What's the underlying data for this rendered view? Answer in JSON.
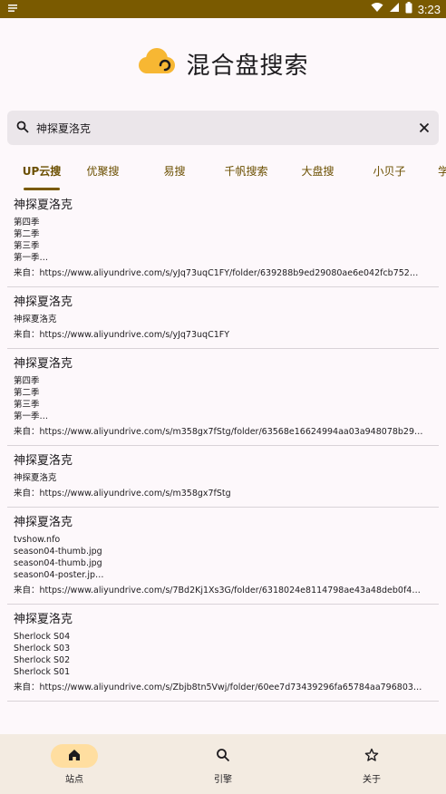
{
  "status_bar": {
    "time": "3:23"
  },
  "header": {
    "title": "混合盘搜索"
  },
  "search": {
    "value": "神探夏洛克"
  },
  "tabs": [
    "UP云搜",
    "优聚搜",
    "易搜",
    "千帆搜索",
    "大盘搜",
    "小贝子",
    "学"
  ],
  "results": [
    {
      "title": "神探夏洛克",
      "lines": [
        "第四季",
        "第二季",
        "第三季",
        "第一季…"
      ],
      "source": "来自：https://www.aliyundrive.com/s/yJq73uqC1FY/folder/639288b9ed29080ae6e042fcb752…"
    },
    {
      "title": "神探夏洛克",
      "lines": [
        "神探夏洛克"
      ],
      "source": "来自：https://www.aliyundrive.com/s/yJq73uqC1FY"
    },
    {
      "title": "神探夏洛克",
      "lines": [
        "第四季",
        "第二季",
        "第三季",
        "第一季…"
      ],
      "source": "来自：https://www.aliyundrive.com/s/m358gx7fStg/folder/63568e16624994aa03a948078b29…"
    },
    {
      "title": "神探夏洛克",
      "lines": [
        "神探夏洛克"
      ],
      "source": "来自：https://www.aliyundrive.com/s/m358gx7fStg"
    },
    {
      "title": "神探夏洛克",
      "lines": [
        "tvshow.nfo",
        "season04-thumb.jpg",
        "season04-thumb.jpg",
        "season04-poster.jp…"
      ],
      "source": "来自：https://www.aliyundrive.com/s/7Bd2Kj1Xs3G/folder/6318024e8114798ae43a48deb0f4…"
    },
    {
      "title": "神探夏洛克",
      "lines": [
        "Sherlock S04",
        "Sherlock S03",
        "Sherlock S02",
        "Sherlock S01"
      ],
      "source": "来自：https://www.aliyundrive.com/s/Zbjb8tn5Vwj/folder/60ee7d73439296fa65784aa796803…"
    }
  ],
  "nav": {
    "items": [
      {
        "label": "站点",
        "icon": "home-icon",
        "active": true
      },
      {
        "label": "引擎",
        "icon": "search-icon",
        "active": false
      },
      {
        "label": "关于",
        "icon": "star-icon",
        "active": false
      }
    ]
  },
  "colors": {
    "status_bar": "#7a5a00",
    "accent": "#6b4f00",
    "logo": "#f7b733",
    "nav_background": "#f3ebe1",
    "nav_active_pill": "#ffdea0"
  }
}
